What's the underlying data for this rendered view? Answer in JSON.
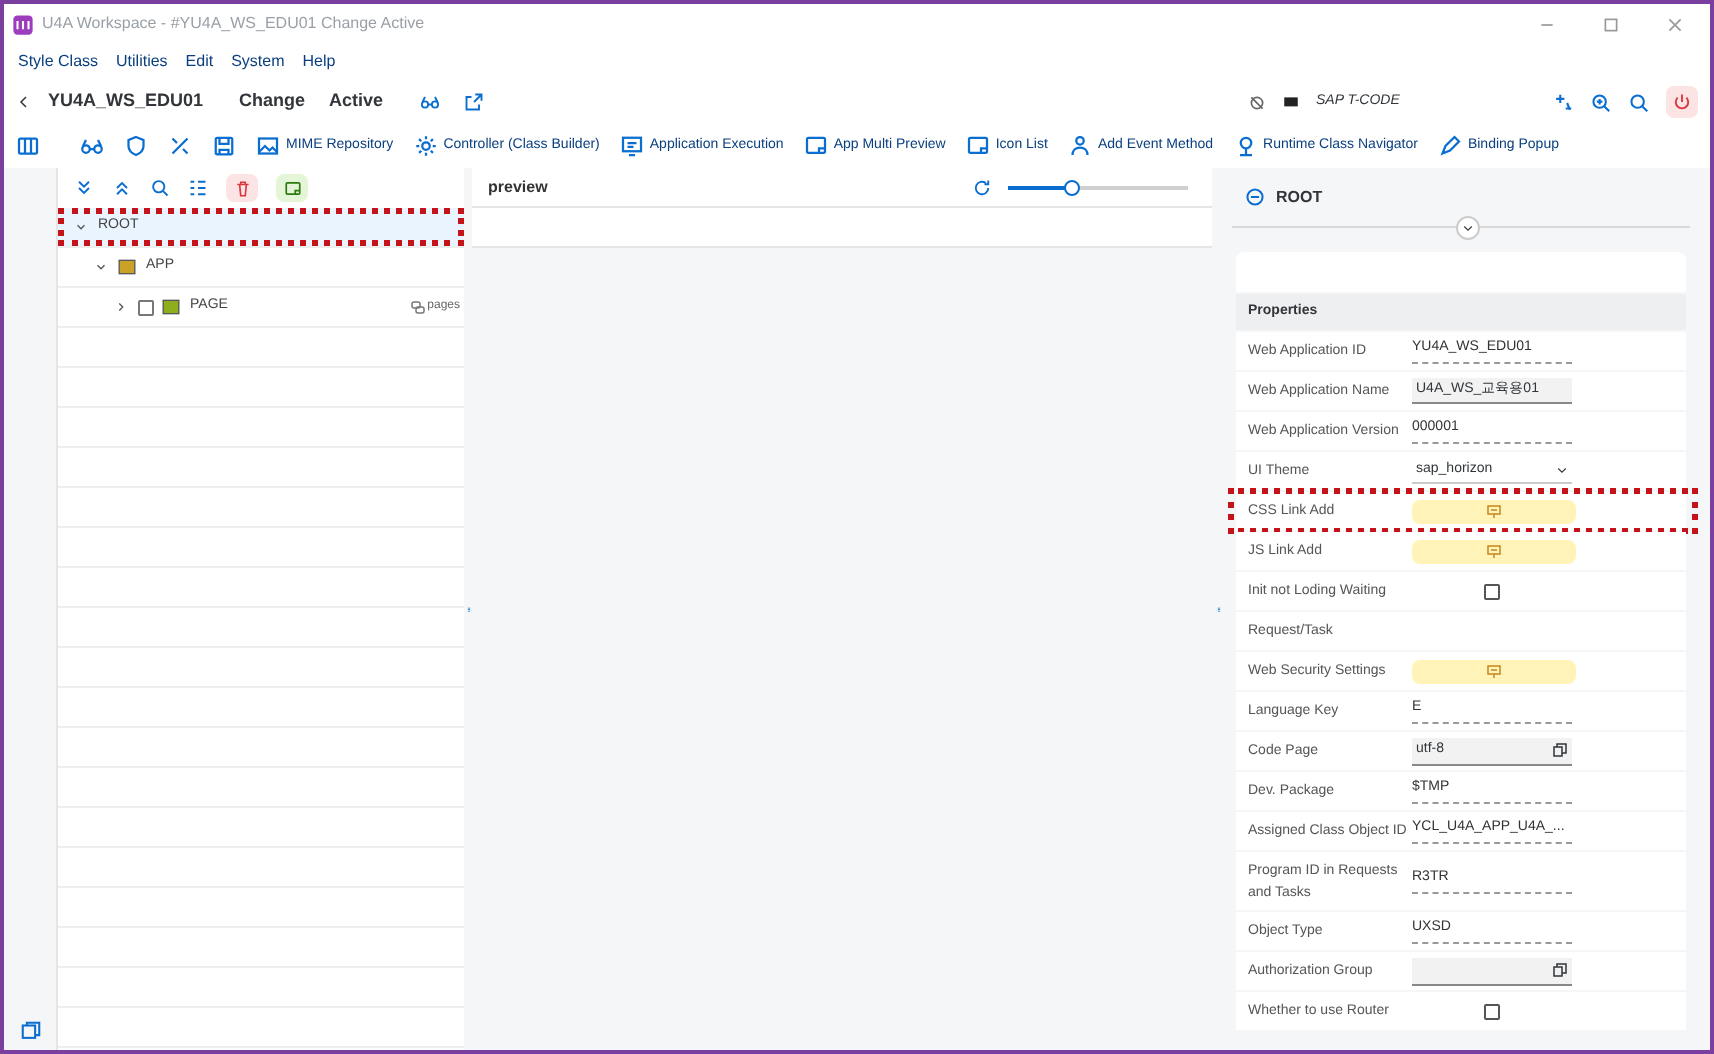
{
  "window": {
    "title": "U4A Workspace - #YU4A_WS_EDU01 Change Active"
  },
  "menu": [
    "Style Class",
    "Utilities",
    "Edit",
    "System",
    "Help"
  ],
  "header": {
    "app_id": "YU4A_WS_EDU01",
    "mode": "Change",
    "status": "Active",
    "tcode_label": "SAP T-CODE"
  },
  "toolbar": [
    {
      "kind": "icon"
    },
    {
      "kind": "icon"
    },
    {
      "kind": "icon"
    },
    {
      "kind": "icon"
    },
    {
      "kind": "link",
      "label": "MIME Repository"
    },
    {
      "kind": "link",
      "label": "Controller (Class Builder)"
    },
    {
      "kind": "link",
      "label": "Application Execution"
    },
    {
      "kind": "link",
      "label": "App Multi Preview"
    },
    {
      "kind": "link",
      "label": "Icon List"
    },
    {
      "kind": "link",
      "label": "Add Event Method"
    },
    {
      "kind": "link",
      "label": "Runtime Class Navigator"
    },
    {
      "kind": "link",
      "label": "Binding Popup"
    }
  ],
  "tree": {
    "nodes": [
      {
        "label": "ROOT",
        "expanded": true,
        "selected": true,
        "highlighted": true,
        "children": [
          {
            "label": "APP",
            "expanded": true,
            "selected": false,
            "children": [
              {
                "label": "PAGE",
                "expanded": false,
                "selected": false,
                "checked": false,
                "aggregation": "pages"
              }
            ]
          }
        ]
      }
    ]
  },
  "preview": {
    "title": "preview",
    "zoom": {
      "level": 0.36
    }
  },
  "properties": {
    "object": "ROOT",
    "section": "Properties",
    "rows": [
      {
        "label": "Web Application ID",
        "kind": "text",
        "value": "YU4A_WS_EDU01"
      },
      {
        "label": "Web Application Name",
        "kind": "input",
        "value": "U4A_WS_교육용01"
      },
      {
        "label": "Web Application Version",
        "kind": "text",
        "value": "000001"
      },
      {
        "label": "UI Theme",
        "kind": "select",
        "value": "sap_horizon"
      },
      {
        "label": "CSS Link Add",
        "kind": "popup",
        "highlighted": true
      },
      {
        "label": "JS Link Add",
        "kind": "popup"
      },
      {
        "label": "Init not Loding Waiting",
        "kind": "checkbox",
        "checked": false
      },
      {
        "label": "Request/Task",
        "kind": "empty"
      },
      {
        "label": "Web Security Settings",
        "kind": "popup"
      },
      {
        "label": "Language Key",
        "kind": "text",
        "value": "E"
      },
      {
        "label": "Code Page",
        "kind": "valuehelp",
        "value": "utf-8"
      },
      {
        "label": "Dev. Package",
        "kind": "text",
        "value": "$TMP"
      },
      {
        "label": "Assigned Class Object ID",
        "kind": "text",
        "value": "YCL_U4A_APP_U4A_..."
      },
      {
        "label": "Program ID in Requests and Tasks",
        "kind": "text",
        "value": "R3TR"
      },
      {
        "label": "Object Type",
        "kind": "text",
        "value": "UXSD"
      },
      {
        "label": "Authorization Group",
        "kind": "valuehelp"
      },
      {
        "label": "Whether to use Router",
        "kind": "checkbox",
        "checked": false
      }
    ]
  }
}
